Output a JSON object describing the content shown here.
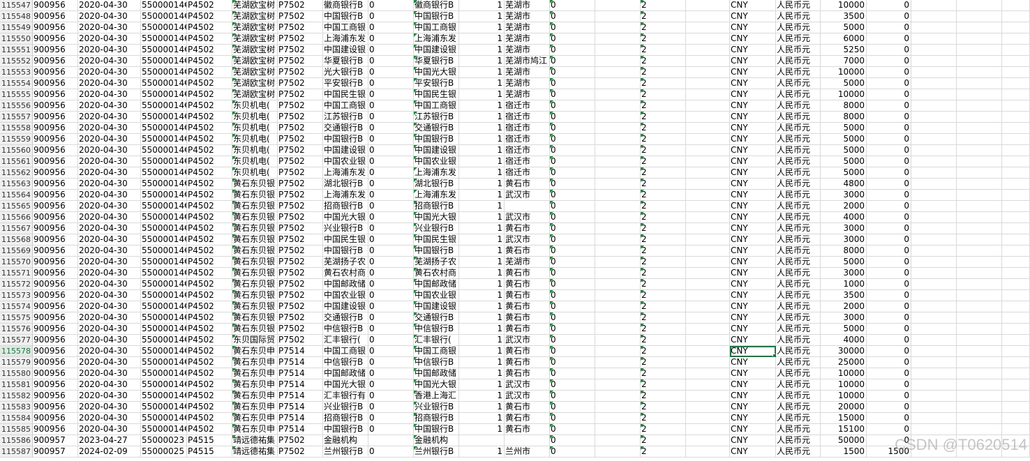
{
  "watermark": "CSDN @T0620514",
  "selected_row": 11557,
  "selected_col": 16,
  "green_flag_cols": [
    4,
    8,
    11,
    12,
    13
  ],
  "rows": [
    {
      "n": "115547",
      "c": [
        "900956",
        "2020-04-30",
        "55000014€",
        "P4502",
        "芜湖欧宝树",
        "P7502",
        "徽商银行B",
        "0",
        "徽商银行B",
        "1",
        "芜湖市",
        "0",
        "",
        "2",
        "",
        "CNY",
        "人民币元",
        "10000",
        "0"
      ]
    },
    {
      "n": "115548",
      "c": [
        "900956",
        "2020-04-30",
        "55000014€",
        "P4502",
        "芜湖欧宝树",
        "P7502",
        "中国银行B",
        "0",
        "中国银行B",
        "1",
        "芜湖市",
        "0",
        "",
        "2",
        "",
        "CNY",
        "人民币元",
        "3500",
        "0"
      ]
    },
    {
      "n": "115549",
      "c": [
        "900956",
        "2020-04-30",
        "55000014€",
        "P4502",
        "芜湖欧宝树",
        "P7502",
        "中国工商银",
        "0",
        "中国工商银",
        "1",
        "芜湖市",
        "0",
        "",
        "2",
        "",
        "CNY",
        "人民币元",
        "5000",
        "0"
      ]
    },
    {
      "n": "115550",
      "c": [
        "900956",
        "2020-04-30",
        "55000014€",
        "P4502",
        "芜湖欧宝树",
        "P7502",
        "上海浦东发",
        "0",
        "上海浦东发",
        "1",
        "芜湖市",
        "0",
        "",
        "2",
        "",
        "CNY",
        "人民币元",
        "6000",
        "0"
      ]
    },
    {
      "n": "115551",
      "c": [
        "900956",
        "2020-04-30",
        "55000014€",
        "P4502",
        "芜湖欧宝树",
        "P7502",
        "中国建设银",
        "0",
        "中国建设银",
        "1",
        "芜湖市",
        "0",
        "",
        "2",
        "",
        "CNY",
        "人民币元",
        "5250",
        "0"
      ]
    },
    {
      "n": "115552",
      "c": [
        "900956",
        "2020-04-30",
        "55000014€",
        "P4502",
        "芜湖欧宝树",
        "P7502",
        "华夏银行B",
        "0",
        "华夏银行B",
        "1",
        "芜湖市鸠江",
        "0",
        "",
        "2",
        "",
        "CNY",
        "人民币元",
        "7000",
        "0"
      ]
    },
    {
      "n": "115553",
      "c": [
        "900956",
        "2020-04-30",
        "55000014€",
        "P4502",
        "芜湖欧宝树",
        "P7502",
        "光大银行B",
        "0",
        "中国光大银",
        "1",
        "芜湖市",
        "0",
        "",
        "2",
        "",
        "CNY",
        "人民币元",
        "10000",
        "0"
      ]
    },
    {
      "n": "115554",
      "c": [
        "900956",
        "2020-04-30",
        "55000014€",
        "P4502",
        "芜湖欧宝树",
        "P7502",
        "平安银行B",
        "0",
        "平安银行B",
        "1",
        "芜湖市",
        "0",
        "",
        "2",
        "",
        "CNY",
        "人民币元",
        "5000",
        "0"
      ]
    },
    {
      "n": "115555",
      "c": [
        "900956",
        "2020-04-30",
        "55000014€",
        "P4502",
        "芜湖欧宝树",
        "P7502",
        "中国民生银",
        "0",
        "中国民生银",
        "1",
        "芜湖市",
        "0",
        "",
        "2",
        "",
        "CNY",
        "人民币元",
        "10000",
        "0"
      ]
    },
    {
      "n": "115556",
      "c": [
        "900956",
        "2020-04-30",
        "55000014€",
        "P4502",
        "东贝机电(",
        "P7502",
        "中国工商银",
        "0",
        "中国工商银",
        "1",
        "宿迁市",
        "0",
        "",
        "2",
        "",
        "CNY",
        "人民币元",
        "8000",
        "0"
      ]
    },
    {
      "n": "115557",
      "c": [
        "900956",
        "2020-04-30",
        "55000014€",
        "P4502",
        "东贝机电(",
        "P7502",
        "江苏银行B",
        "0",
        "江苏银行B",
        "1",
        "宿迁市",
        "0",
        "",
        "2",
        "",
        "CNY",
        "人民币元",
        "8000",
        "0"
      ]
    },
    {
      "n": "115558",
      "c": [
        "900956",
        "2020-04-30",
        "55000014€",
        "P4502",
        "东贝机电(",
        "P7502",
        "交通银行B",
        "0",
        "交通银行B",
        "1",
        "宿迁市",
        "0",
        "",
        "2",
        "",
        "CNY",
        "人民币元",
        "5000",
        "0"
      ]
    },
    {
      "n": "115559",
      "c": [
        "900956",
        "2020-04-30",
        "55000014€",
        "P4502",
        "东贝机电(",
        "P7502",
        "中国银行B",
        "0",
        "中国银行B",
        "1",
        "宿迁市",
        "0",
        "",
        "2",
        "",
        "CNY",
        "人民币元",
        "5000",
        "0"
      ]
    },
    {
      "n": "115560",
      "c": [
        "900956",
        "2020-04-30",
        "55000014€",
        "P4502",
        "东贝机电(",
        "P7502",
        "中国建设银",
        "0",
        "中国建设银",
        "1",
        "宿迁市",
        "0",
        "",
        "2",
        "",
        "CNY",
        "人民币元",
        "5000",
        "0"
      ]
    },
    {
      "n": "115561",
      "c": [
        "900956",
        "2020-04-30",
        "55000014€",
        "P4502",
        "东贝机电(",
        "P7502",
        "中国农业银",
        "0",
        "中国农业银",
        "1",
        "宿迁市",
        "0",
        "",
        "2",
        "",
        "CNY",
        "人民币元",
        "5000",
        "0"
      ]
    },
    {
      "n": "115562",
      "c": [
        "900956",
        "2020-04-30",
        "55000014€",
        "P4502",
        "东贝机电(",
        "P7502",
        "上海浦东发",
        "0",
        "上海浦东发",
        "1",
        "宿迁市",
        "0",
        "",
        "2",
        "",
        "CNY",
        "人民币元",
        "5000",
        "0"
      ]
    },
    {
      "n": "115563",
      "c": [
        "900956",
        "2020-04-30",
        "55000014€",
        "P4502",
        "黄石东贝银",
        "P7502",
        "湖北银行B",
        "0",
        "湖北银行B",
        "1",
        "黄石市",
        "0",
        "",
        "2",
        "",
        "CNY",
        "人民币元",
        "4800",
        "0"
      ]
    },
    {
      "n": "115564",
      "c": [
        "900956",
        "2020-04-30",
        "55000014€",
        "P4502",
        "黄石东贝银",
        "P7502",
        "上海浦东发",
        "0",
        "上海浦东发",
        "1",
        "武汉市",
        "0",
        "",
        "2",
        "",
        "CNY",
        "人民币元",
        "3000",
        "0"
      ]
    },
    {
      "n": "115565",
      "c": [
        "900956",
        "2020-04-30",
        "55000014€",
        "P4502",
        "黄石东贝银",
        "P7502",
        "招商银行B",
        "0",
        "招商银行B",
        "1",
        "",
        "0",
        "",
        "2",
        "",
        "CNY",
        "人民币元",
        "2000",
        "0"
      ]
    },
    {
      "n": "115566",
      "c": [
        "900956",
        "2020-04-30",
        "55000014€",
        "P4502",
        "黄石东贝银",
        "P7502",
        "中国光大银",
        "0",
        "中国光大银",
        "1",
        "武汉市",
        "0",
        "",
        "2",
        "",
        "CNY",
        "人民币元",
        "4000",
        "0"
      ]
    },
    {
      "n": "115567",
      "c": [
        "900956",
        "2020-04-30",
        "55000014€",
        "P4502",
        "黄石东贝银",
        "P7502",
        "兴业银行B",
        "0",
        "兴业银行B",
        "1",
        "黄石市",
        "0",
        "",
        "2",
        "",
        "CNY",
        "人民币元",
        "3000",
        "0"
      ]
    },
    {
      "n": "115568",
      "c": [
        "900956",
        "2020-04-30",
        "55000014€",
        "P4502",
        "黄石东贝银",
        "P7502",
        "中国民生银",
        "0",
        "中国民生银",
        "1",
        "武汉市",
        "0",
        "",
        "2",
        "",
        "CNY",
        "人民币元",
        "3000",
        "0"
      ]
    },
    {
      "n": "115569",
      "c": [
        "900956",
        "2020-04-30",
        "55000014€",
        "P4502",
        "黄石东贝银",
        "P7502",
        "中国银行B",
        "0",
        "中国银行B",
        "1",
        "黄石市",
        "0",
        "",
        "2",
        "",
        "CNY",
        "人民币元",
        "8000",
        "0"
      ]
    },
    {
      "n": "115570",
      "c": [
        "900956",
        "2020-04-30",
        "55000014€",
        "P4502",
        "黄石东贝银",
        "P7502",
        "芜湖扬子农",
        "0",
        "芜湖扬子农",
        "1",
        "芜湖市",
        "0",
        "",
        "2",
        "",
        "CNY",
        "人民币元",
        "5000",
        "0"
      ]
    },
    {
      "n": "115571",
      "c": [
        "900956",
        "2020-04-30",
        "55000014€",
        "P4502",
        "黄石东贝银",
        "P7502",
        "黄石农村商",
        "0",
        "黄石农村商",
        "1",
        "黄石市",
        "0",
        "",
        "2",
        "",
        "CNY",
        "人民币元",
        "3000",
        "0"
      ]
    },
    {
      "n": "115572",
      "c": [
        "900956",
        "2020-04-30",
        "55000014€",
        "P4502",
        "黄石东贝银",
        "P7502",
        "中国邮政储",
        "0",
        "中国邮政储",
        "1",
        "黄石市",
        "0",
        "",
        "2",
        "",
        "CNY",
        "人民币元",
        "1000",
        "0"
      ]
    },
    {
      "n": "115573",
      "c": [
        "900956",
        "2020-04-30",
        "55000014€",
        "P4502",
        "黄石东贝银",
        "P7502",
        "中国农业银",
        "0",
        "中国农业银",
        "1",
        "黄石市",
        "0",
        "",
        "2",
        "",
        "CNY",
        "人民币元",
        "3500",
        "0"
      ]
    },
    {
      "n": "115574",
      "c": [
        "900956",
        "2020-04-30",
        "55000014€",
        "P4502",
        "黄石东贝银",
        "P7502",
        "中国建设银",
        "0",
        "中国建设银",
        "1",
        "黄石市",
        "0",
        "",
        "2",
        "",
        "CNY",
        "人民币元",
        "2000",
        "0"
      ]
    },
    {
      "n": "115575",
      "c": [
        "900956",
        "2020-04-30",
        "55000014€",
        "P4502",
        "黄石东贝银",
        "P7502",
        "交通银行B",
        "0",
        "交通银行B",
        "1",
        "黄石市",
        "0",
        "",
        "2",
        "",
        "CNY",
        "人民币元",
        "3000",
        "0"
      ]
    },
    {
      "n": "115576",
      "c": [
        "900956",
        "2020-04-30",
        "55000014€",
        "P4502",
        "黄石东贝银",
        "P7502",
        "中信银行B",
        "0",
        "中信银行B",
        "1",
        "黄石市",
        "0",
        "",
        "2",
        "",
        "CNY",
        "人民币元",
        "5000",
        "0"
      ]
    },
    {
      "n": "115577",
      "c": [
        "900956",
        "2020-04-30",
        "55000014€",
        "P4502",
        "东贝国际贸",
        "P7502",
        "汇丰银行(",
        "0",
        "汇丰银行(",
        "1",
        "武汉市",
        "0",
        "",
        "2",
        "",
        "CNY",
        "人民币元",
        "4000",
        "0"
      ]
    },
    {
      "n": "115578",
      "c": [
        "900956",
        "2020-04-30",
        "55000014€",
        "P4502",
        "黄石东贝申",
        "P7514",
        "中国工商银",
        "0",
        "中国工商银",
        "1",
        "黄石市",
        "0",
        "",
        "2",
        "",
        "CNY",
        "人民币元",
        "30000",
        "0"
      ]
    },
    {
      "n": "115579",
      "c": [
        "900956",
        "2020-04-30",
        "55000014€",
        "P4502",
        "黄石东贝申",
        "P7514",
        "中信银行B",
        "0",
        "中信银行B",
        "1",
        "黄石市",
        "0",
        "",
        "2",
        "",
        "CNY",
        "人民币元",
        "25000",
        "0"
      ]
    },
    {
      "n": "115580",
      "c": [
        "900956",
        "2020-04-30",
        "55000014€",
        "P4502",
        "黄石东贝申",
        "P7514",
        "中国邮政储",
        "0",
        "中国邮政储",
        "1",
        "黄石市",
        "0",
        "",
        "2",
        "",
        "CNY",
        "人民币元",
        "10000",
        "0"
      ]
    },
    {
      "n": "115581",
      "c": [
        "900956",
        "2020-04-30",
        "55000014€",
        "P4502",
        "黄石东贝申",
        "P7514",
        "中国光大银",
        "0",
        "中国光大银",
        "1",
        "武汉市",
        "0",
        "",
        "2",
        "",
        "CNY",
        "人民币元",
        "10000",
        "0"
      ]
    },
    {
      "n": "115582",
      "c": [
        "900956",
        "2020-04-30",
        "55000014€",
        "P4502",
        "黄石东贝申",
        "P7514",
        "汇丰银行有",
        "0",
        "香港上海汇",
        "1",
        "武汉市",
        "0",
        "",
        "2",
        "",
        "CNY",
        "人民币元",
        "10000",
        "0"
      ]
    },
    {
      "n": "115583",
      "c": [
        "900956",
        "2020-04-30",
        "55000014€",
        "P4502",
        "黄石东贝申",
        "P7514",
        "兴业银行B",
        "0",
        "兴业银行B",
        "1",
        "黄石市",
        "0",
        "",
        "2",
        "",
        "CNY",
        "人民币元",
        "20000",
        "0"
      ]
    },
    {
      "n": "115584",
      "c": [
        "900956",
        "2020-04-30",
        "55000014€",
        "P4502",
        "黄石东贝申",
        "P7514",
        "招商银行B",
        "0",
        "招商银行B",
        "1",
        "黄石市",
        "0",
        "",
        "2",
        "",
        "CNY",
        "人民币元",
        "15000",
        "0"
      ]
    },
    {
      "n": "115585",
      "c": [
        "900956",
        "2020-04-30",
        "55000014€",
        "P4502",
        "黄石东贝申",
        "P7514",
        "中国银行B",
        "0",
        "中国银行B",
        "1",
        "黄石市",
        "0",
        "",
        "2",
        "",
        "CNY",
        "人民币元",
        "15100",
        "0"
      ]
    },
    {
      "n": "115586",
      "c": [
        "900957",
        "2023-04-27",
        "55000023",
        "P4515",
        "靖远德祐集",
        "P7502",
        "金融机构",
        "",
        "金融机构",
        "",
        "",
        "0",
        "",
        "2",
        "",
        "CNY",
        "人民币元",
        "50000",
        "0"
      ]
    },
    {
      "n": "115587",
      "c": [
        "900957",
        "2024-02-09",
        "55000025",
        "P4515",
        "靖远德祐集",
        "P7502",
        "兰州银行B",
        "0",
        "兰州银行B",
        "1",
        "兰州市",
        "0",
        "",
        "2",
        "",
        "CNY",
        "人民币元",
        "1500",
        "1500"
      ]
    }
  ]
}
